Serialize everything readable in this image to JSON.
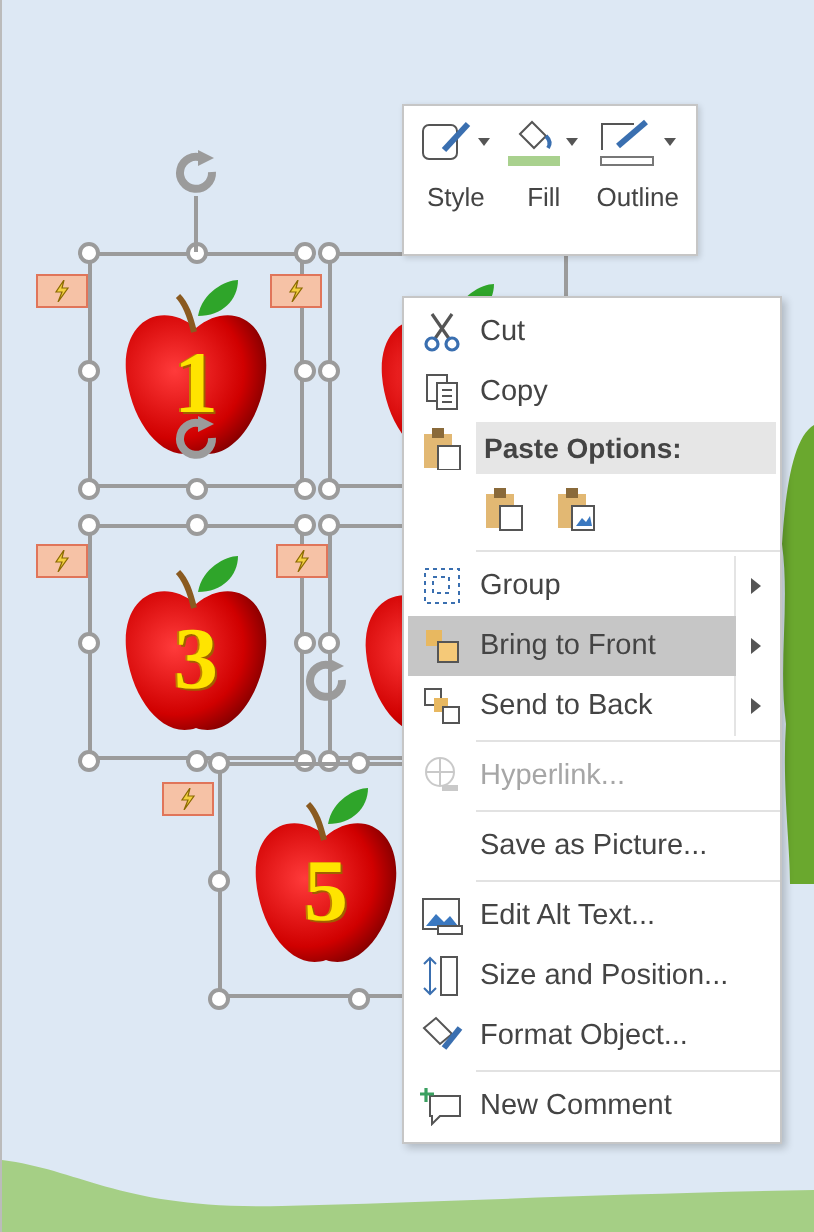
{
  "slide": {
    "apples": [
      {
        "label": "1"
      },
      {
        "label": "3"
      },
      {
        "label": "5"
      }
    ]
  },
  "mini_toolbar": {
    "buttons": [
      {
        "label": "Style"
      },
      {
        "label": "Fill"
      },
      {
        "label": "Outline"
      }
    ]
  },
  "context_menu": {
    "items": [
      {
        "kind": "item",
        "label": "Cut",
        "submenu": false,
        "disabled": false,
        "selected": false
      },
      {
        "kind": "item",
        "label": "Copy",
        "submenu": false,
        "disabled": false,
        "selected": false
      },
      {
        "kind": "header",
        "label": "Paste Options:"
      },
      {
        "kind": "paste"
      },
      {
        "kind": "separator"
      },
      {
        "kind": "item",
        "label": "Group",
        "submenu": true,
        "disabled": false,
        "selected": false
      },
      {
        "kind": "item",
        "label": "Bring to Front",
        "submenu": true,
        "disabled": false,
        "selected": true
      },
      {
        "kind": "item",
        "label": "Send to Back",
        "submenu": true,
        "disabled": false,
        "selected": false
      },
      {
        "kind": "separator"
      },
      {
        "kind": "item",
        "label": "Hyperlink...",
        "submenu": false,
        "disabled": true,
        "selected": false
      },
      {
        "kind": "separator"
      },
      {
        "kind": "item",
        "label": "Save as Picture...",
        "submenu": false,
        "disabled": false,
        "selected": false
      },
      {
        "kind": "separator"
      },
      {
        "kind": "item",
        "label": "Edit Alt Text...",
        "submenu": false,
        "disabled": false,
        "selected": false
      },
      {
        "kind": "item",
        "label": "Size and Position...",
        "submenu": false,
        "disabled": false,
        "selected": false
      },
      {
        "kind": "item",
        "label": "Format Object...",
        "submenu": false,
        "disabled": false,
        "selected": false
      },
      {
        "kind": "separator"
      },
      {
        "kind": "item",
        "label": "New Comment",
        "submenu": false,
        "disabled": false,
        "selected": false
      }
    ]
  }
}
